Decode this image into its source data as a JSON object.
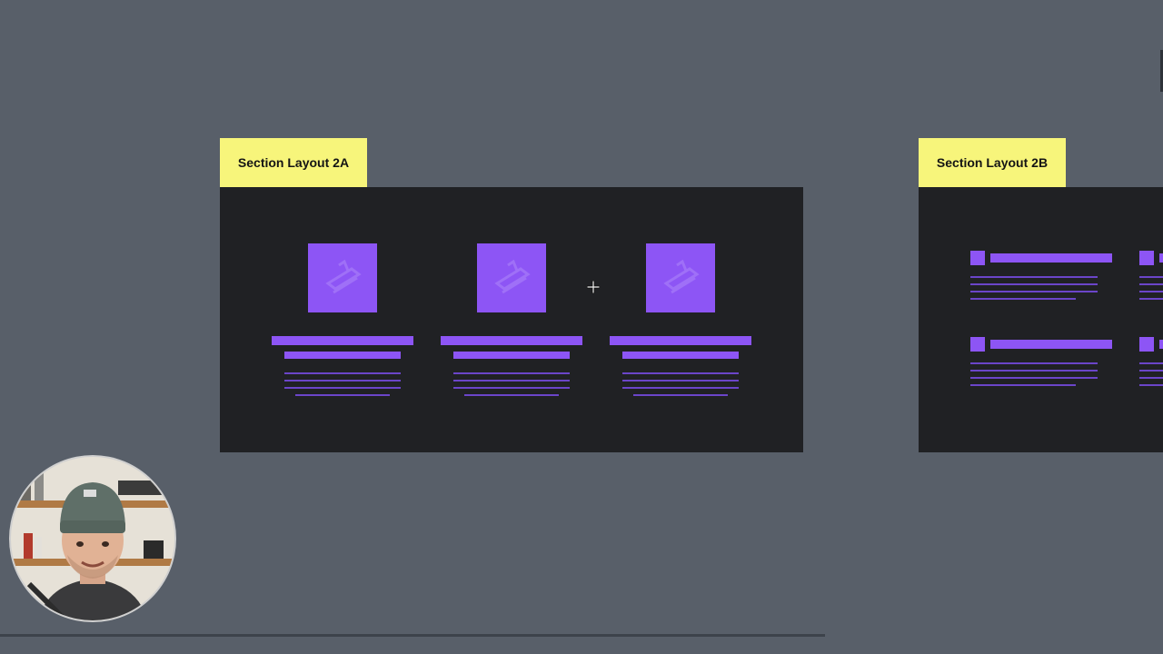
{
  "canvas": {
    "background": "#585f69"
  },
  "frames": [
    {
      "label": "Section Layout 2A",
      "label_color": "#f7f57b",
      "frame_color": "#202124",
      "layout": "three-column cards"
    },
    {
      "label": "Section Layout 2B",
      "label_color": "#f7f57b",
      "frame_color": "#202124",
      "layout": "two-row list"
    }
  ],
  "accent": "#8d55f5",
  "line_color": "#6b45c9",
  "icons": {
    "cursor": "crosshair-move-icon",
    "placeholder_image": "image-placeholder-icon",
    "webcam": "presenter-avatar"
  }
}
